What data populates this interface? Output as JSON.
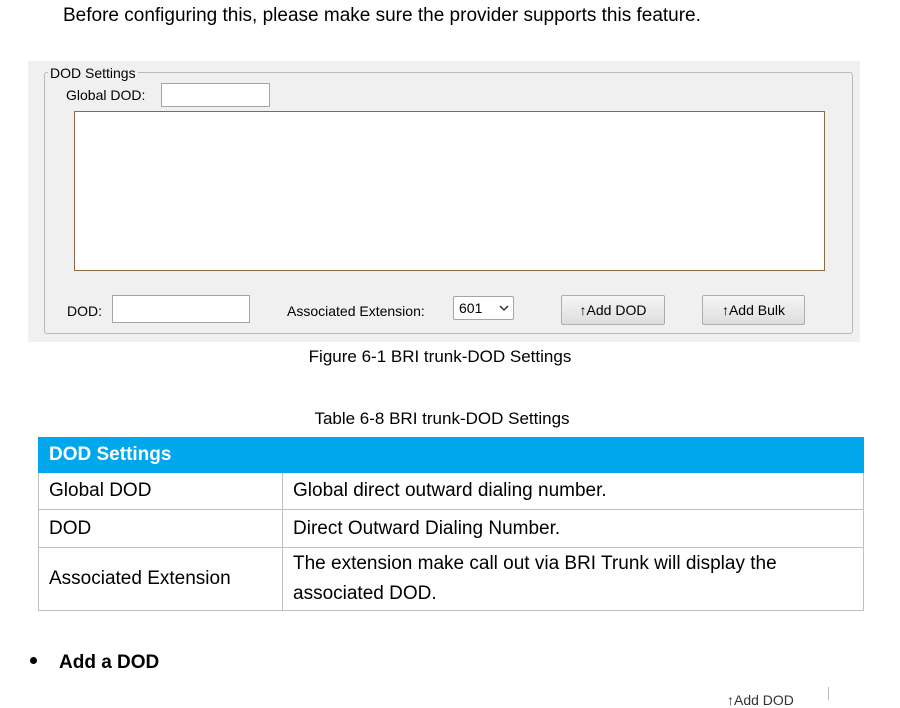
{
  "intro_text": "Before configuring this, please make sure the provider supports this feature.",
  "figure": {
    "group_title": "DOD Settings",
    "global_dod_label": "Global DOD:",
    "global_dod_value": "",
    "dod_label": "DOD:",
    "dod_value": "",
    "associated_extension_label": "Associated Extension:",
    "associated_extension_value": "601",
    "add_dod_button": "↑Add DOD",
    "add_bulk_button": "↑Add Bulk",
    "caption": "Figure 6-1 BRI trunk-DOD Settings"
  },
  "table": {
    "caption": "Table 6-8 BRI trunk-DOD Settings",
    "header": "DOD Settings",
    "rows": [
      {
        "name": "Global DOD",
        "description": "Global direct outward dialing number."
      },
      {
        "name": "DOD",
        "description": "Direct Outward Dialing Number."
      },
      {
        "name": "Associated Extension",
        "description": "The extension make call out via BRI Trunk will display the associated DOD."
      }
    ]
  },
  "bullet": {
    "text": "Add a DOD"
  },
  "cut_off_text": "↑Add DOD",
  "colors": {
    "table_header_bg": "#00a7ec",
    "figure_bg": "#f0f0f0",
    "list_border": "#8d6a46"
  }
}
